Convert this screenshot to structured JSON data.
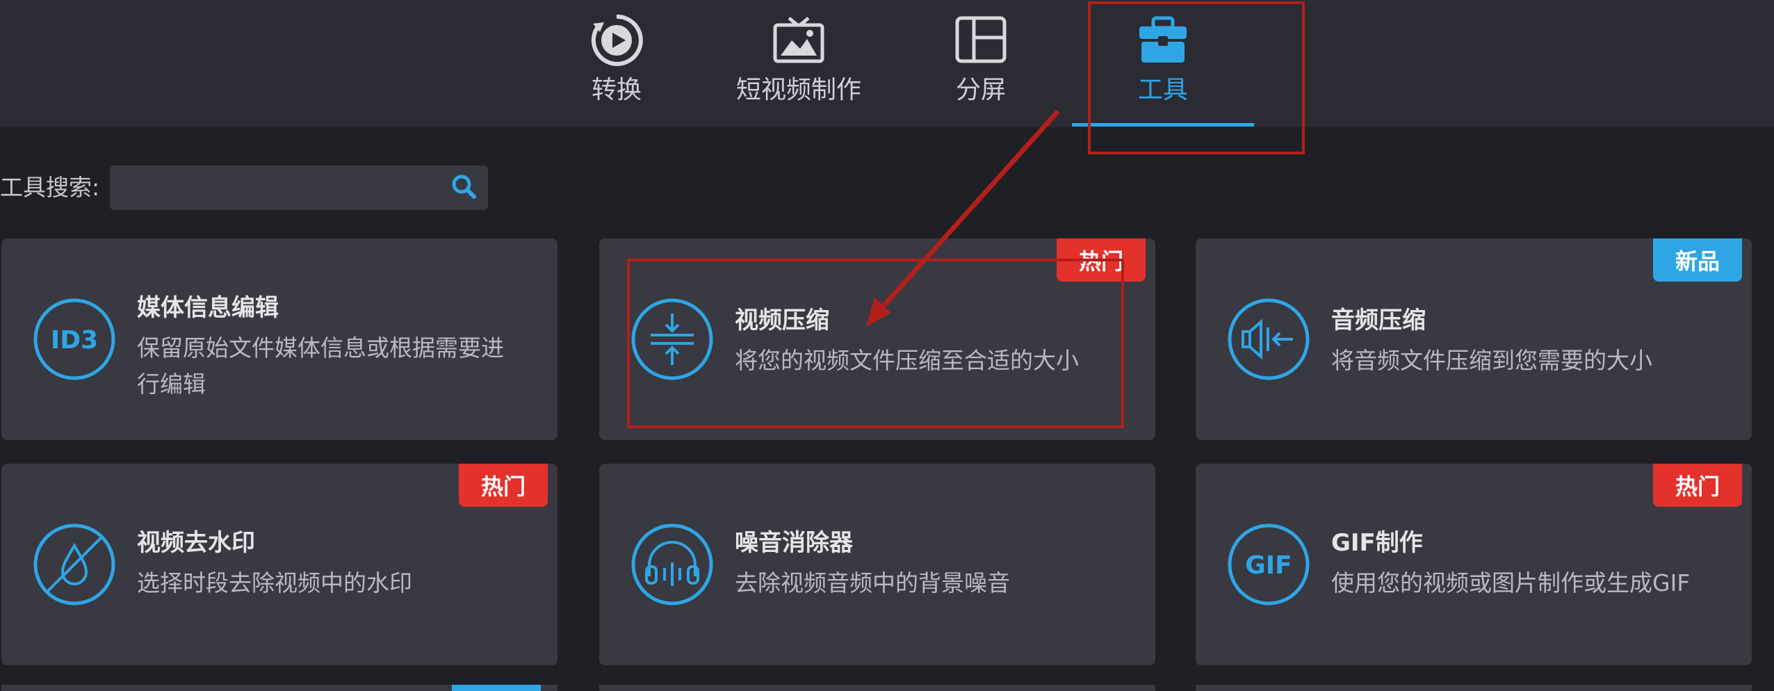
{
  "nav": {
    "tabs": [
      {
        "label": "转换",
        "icon": "convert-play-icon"
      },
      {
        "label": "短视频制作",
        "icon": "tv-icon"
      },
      {
        "label": "分屏",
        "icon": "split-screen-icon"
      },
      {
        "label": "工具",
        "icon": "toolbox-icon",
        "active": true
      }
    ]
  },
  "search": {
    "label": "工具搜索:",
    "value": ""
  },
  "cards": [
    {
      "title": "媒体信息编辑",
      "desc": "保留原始文件媒体信息或根据需要进行编辑",
      "icon": "id3-icon",
      "icon_text": "ID3"
    },
    {
      "title": "视频压缩",
      "desc": "将您的视频文件压缩至合适的大小",
      "icon": "compress-icon",
      "badge": "热门"
    },
    {
      "title": "音频压缩",
      "desc": "将音频文件压缩到您需要的大小",
      "icon": "speaker-compress-icon",
      "badge": "新品"
    },
    {
      "title": "视频去水印",
      "desc": "选择时段去除视频中的水印",
      "icon": "watermark-remove-icon",
      "badge": "热门"
    },
    {
      "title": "噪音消除器",
      "desc": "去除视频音频中的背景噪音",
      "icon": "headphones-icon"
    },
    {
      "title": "GIF制作",
      "desc": "使用您的视频或图片制作或生成GIF",
      "icon": "gif-icon",
      "icon_text": "GIF",
      "badge": "热门"
    }
  ],
  "colors": {
    "accent": "#2ea6e6",
    "hot_badge": "#e3312c",
    "new_badge": "#2ea6e6",
    "highlight": "#b31f1a"
  }
}
